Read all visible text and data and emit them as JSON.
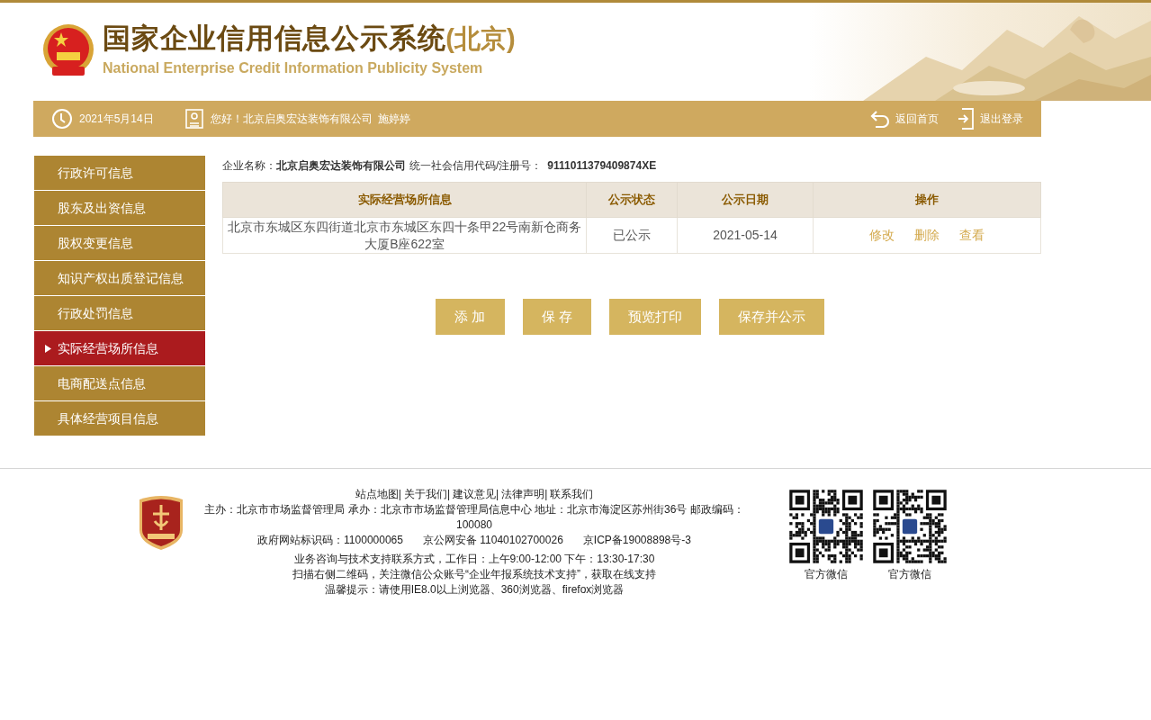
{
  "header": {
    "title": "国家企业信用信息公示系统",
    "title_suffix": "(北京)",
    "subtitle": "National Enterprise Credit Information Publicity System"
  },
  "nav": {
    "date": "2021年5月14日",
    "greeting": "您好！北京启奥宏达装饰有限公司  施婷婷",
    "links": [
      {
        "kind": "home",
        "label": "返回首页"
      },
      {
        "kind": "logout",
        "label": "退出登录"
      }
    ]
  },
  "sidebar": {
    "items": [
      {
        "label": "行政许可信息",
        "selected": false
      },
      {
        "label": "股东及出资信息",
        "selected": false
      },
      {
        "label": "股权变更信息",
        "selected": false
      },
      {
        "label": "知识产权出质登记信息",
        "selected": false
      },
      {
        "label": "行政处罚信息",
        "selected": false
      },
      {
        "label": "实际经营场所信息",
        "selected": true
      },
      {
        "label": "电商配送点信息",
        "selected": false
      },
      {
        "label": "具体经营项目信息",
        "selected": false
      }
    ]
  },
  "company": {
    "name_label": "企业名称：",
    "name": "北京启奥宏达装饰有限公司",
    "code_label": "统一社会信用代码/注册号：",
    "code": "9111011379409874XE"
  },
  "table": {
    "columns": [
      "实际经营场所信息",
      "公示状态",
      "公示日期",
      "操作"
    ],
    "rows": [
      {
        "address": "北京市东城区东四街道北京市东城区东四十条甲22号南新仓商务大厦B座622室",
        "status": "已公示",
        "date": "2021-05-14",
        "actions": [
          "修改",
          "删除",
          "查看"
        ]
      }
    ]
  },
  "buttons": [
    "添 加",
    "保 存",
    "预览打印",
    "保存并公示"
  ],
  "footer": {
    "links": [
      "站点地图|",
      "关于我们|",
      "建议意见|",
      "法律声明|",
      "联系我们"
    ],
    "sponsor": "主办：北京市市场监督管理局 承办：北京市市场监督管理局信息中心 地址：北京市海淀区苏州街36号 邮政编码：100080",
    "registrations": [
      "政府网站标识码：1100000065",
      "京公网安备 11040102700026",
      "京ICP备19008898号-3"
    ],
    "notes": [
      "业务咨询与技术支持联系方式，工作日：上午9:00-12:00 下午：13:30-17:30",
      "扫描右侧二维码，关注微信公众账号“企业年报系统技术支持”，获取在线支持",
      "温馨提示：请使用IE8.0以上浏览器、360浏览器、firefox浏览器"
    ],
    "qr_codes": [
      {
        "label": "官方微信"
      },
      {
        "label": "官方微信"
      }
    ]
  }
}
